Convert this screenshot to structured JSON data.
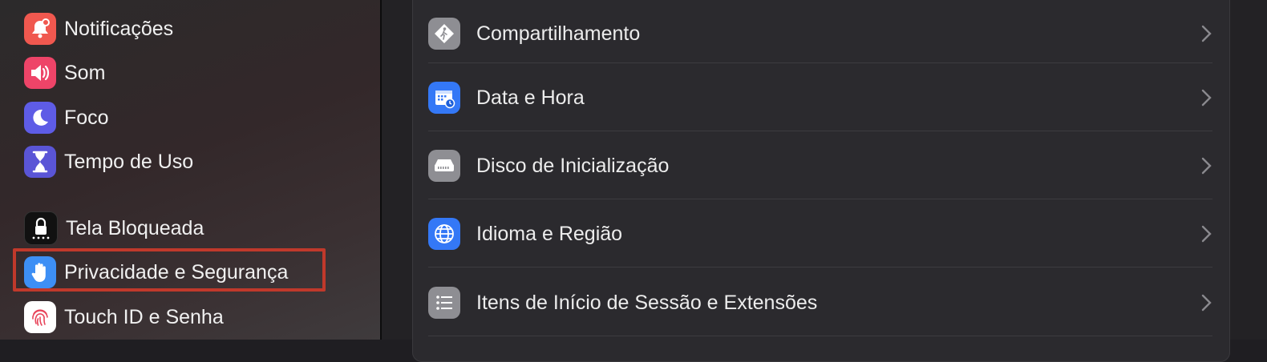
{
  "sidebar": {
    "items": [
      {
        "label": "Notificações",
        "icon": "bell-badge-icon",
        "color": "#f0584f"
      },
      {
        "label": "Som",
        "icon": "speaker-icon",
        "color": "#ee4468"
      },
      {
        "label": "Foco",
        "icon": "moon-icon",
        "color": "#5e5ce6"
      },
      {
        "label": "Tempo de Uso",
        "icon": "hourglass-icon",
        "color": "#5a55d6"
      },
      {
        "label": "Tela Bloqueada",
        "icon": "lock-icon",
        "color": "#111111"
      },
      {
        "label": "Privacidade e Segurança",
        "icon": "hand-icon",
        "color": "#3d8ff5"
      },
      {
        "label": "Touch ID e Senha",
        "icon": "fingerprint-icon",
        "color": "#ffffff"
      }
    ],
    "highlighted_item": "Privacidade e Segurança",
    "highlight_color": "#c0392b"
  },
  "main": {
    "rows": [
      {
        "label": "Compartilhamento",
        "icon": "sharing-icon",
        "color": "#8e8e93"
      },
      {
        "label": "Data e Hora",
        "icon": "calendar-clock-icon",
        "color": "#3478f6"
      },
      {
        "label": "Disco de Inicialização",
        "icon": "disk-icon",
        "color": "#8e8e93"
      },
      {
        "label": "Idioma e Região",
        "icon": "globe-icon",
        "color": "#3478f6"
      },
      {
        "label": "Itens de Início de Sessão e Extensões",
        "icon": "list-icon",
        "color": "#8e8e93"
      }
    ]
  }
}
